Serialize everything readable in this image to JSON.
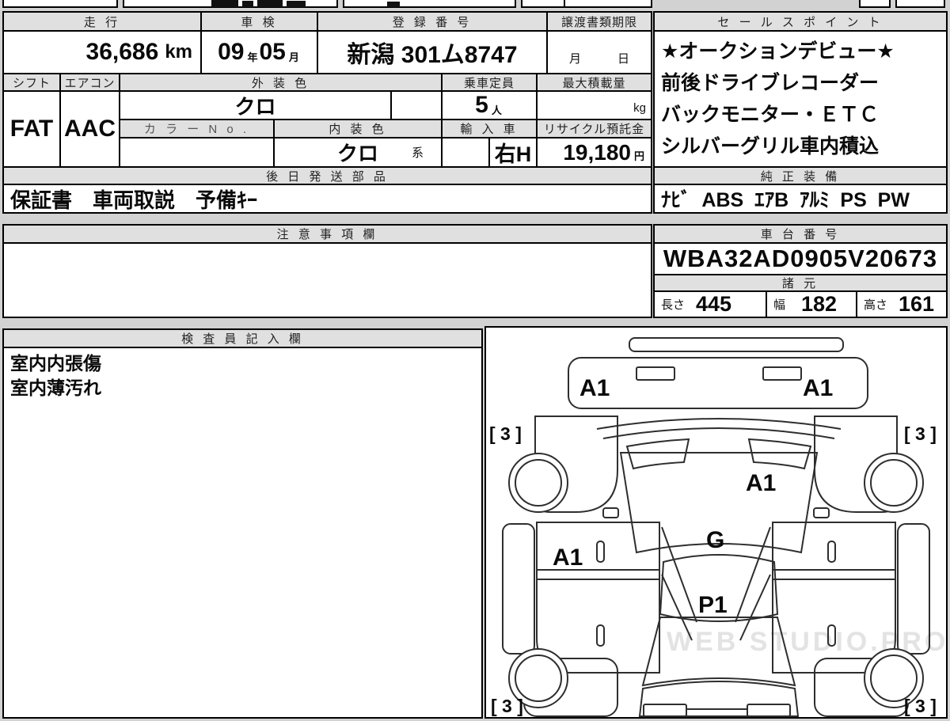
{
  "page": {
    "watermark": "WEB STUDIO.PRO"
  },
  "top_table": {
    "mileage_label": "走 行",
    "mileage_value": "36,686",
    "mileage_unit": "km",
    "inspection_label": "車 検",
    "inspection_year": "09",
    "inspection_year_unit": "年",
    "inspection_month": "05",
    "inspection_month_unit": "月",
    "registration_label": "登 録 番 号",
    "registration_value": "新潟 301ム8747",
    "transfer_label": "譲渡書類期限",
    "transfer_value_month": "月",
    "transfer_value_day": "日",
    "shift_label": "シフト",
    "shift_value": "FAT",
    "aircon_label": "エアコン",
    "aircon_value": "AAC",
    "exterior_label": "外 装 色",
    "exterior_value": "クロ",
    "capacity_label": "乗車定員",
    "capacity_value": "5",
    "capacity_unit": "人",
    "load_label": "最大積載量",
    "load_unit": "kg",
    "colorno_label": "カ ラ ー N o .",
    "interior_label": "内 装 色",
    "interior_value": "クロ",
    "interior_suffix": "系",
    "import_label": "輸 入 車",
    "import_value": "右H",
    "recycle_label": "リサイクル預託金",
    "recycle_value": "19,180",
    "recycle_unit": "円",
    "later_parts_label": "後 日 発 送 部 品",
    "later_parts_value": "保証書　車両取説　予備ｷｰ"
  },
  "sales_points": {
    "label": "セ ー ル ス ポ イ ン ト",
    "lines": [
      "★オークションデビュー★",
      "前後ドライブレコーダー",
      "バックモニター・ＥＴＣ",
      "シルバーグリル車内積込"
    ]
  },
  "genuine_equipment": {
    "label": "純 正 装 備",
    "value": "ﾅﾋﾞ  ABS  ｴｱB  ｱﾙﾐ  PS  PW"
  },
  "notes": {
    "label": "注 意 事 項 欄",
    "value": ""
  },
  "chassis": {
    "label": "車 台 番 号",
    "value": "WBA32AD0905V20673"
  },
  "specs": {
    "label": "諸 元",
    "length_label": "長さ",
    "length_value": "445",
    "width_label": "幅",
    "width_value": "182",
    "height_label": "高さ",
    "height_value": "161"
  },
  "inspector": {
    "label": "検 査 員 記 入 欄",
    "lines": [
      "室内内張傷",
      "室内薄汚れ"
    ]
  },
  "diagram": {
    "front_bumper_left": "A1",
    "front_bumper_right": "A1",
    "front_wheel_left": "[ 3 ]",
    "front_wheel_right": "[ 3 ]",
    "windshield_mark": "A1",
    "hood_mark": "G",
    "door_left_mark": "A1",
    "roof_mark": "P1",
    "rear_wheel_left": "[ 3 ]",
    "rear_wheel_right": "[ 3 ]"
  }
}
